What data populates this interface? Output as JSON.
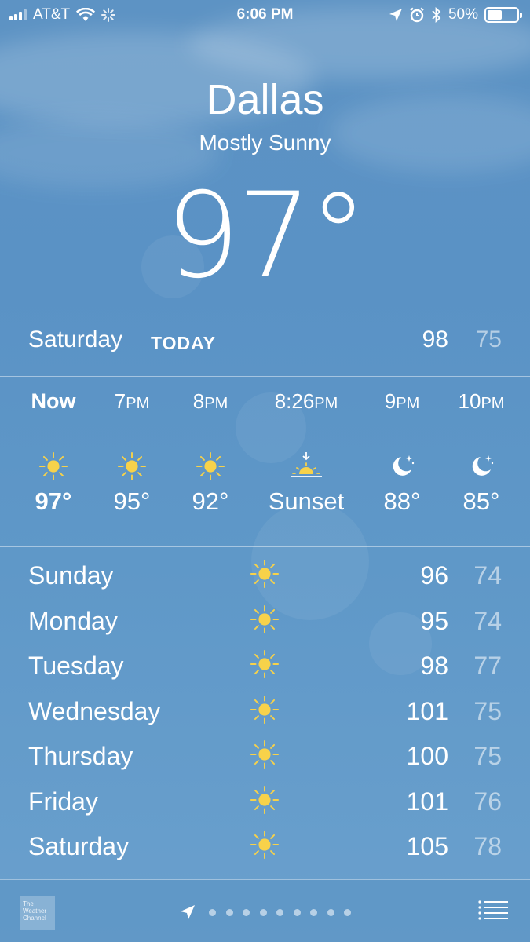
{
  "status_bar": {
    "carrier": "AT&T",
    "time": "6:06 PM",
    "battery": "50%",
    "battery_level": 0.5
  },
  "location": {
    "city": "Dallas",
    "condition": "Mostly Sunny",
    "temperature": "97°"
  },
  "today": {
    "day": "Saturday",
    "label": "TODAY",
    "high": "98",
    "low": "75"
  },
  "hourly": [
    {
      "time": "Now",
      "ampm": "",
      "icon": "sun-icon",
      "temp": "97°",
      "is_now": true
    },
    {
      "time": "7",
      "ampm": "PM",
      "icon": "sun-icon",
      "temp": "95°"
    },
    {
      "time": "8",
      "ampm": "PM",
      "icon": "sun-icon",
      "temp": "92°"
    },
    {
      "time": "8:26",
      "ampm": "PM",
      "icon": "sunset-icon",
      "temp": "Sunset"
    },
    {
      "time": "9",
      "ampm": "PM",
      "icon": "moon-icon",
      "temp": "88°"
    },
    {
      "time": "10",
      "ampm": "PM",
      "icon": "moon-icon",
      "temp": "85°"
    }
  ],
  "daily": [
    {
      "day": "Sunday",
      "icon": "sun-icon",
      "high": "96",
      "low": "74"
    },
    {
      "day": "Monday",
      "icon": "sun-icon",
      "high": "95",
      "low": "74"
    },
    {
      "day": "Tuesday",
      "icon": "sun-icon",
      "high": "98",
      "low": "77"
    },
    {
      "day": "Wednesday",
      "icon": "sun-icon",
      "high": "101",
      "low": "75"
    },
    {
      "day": "Thursday",
      "icon": "sun-icon",
      "high": "100",
      "low": "75"
    },
    {
      "day": "Friday",
      "icon": "sun-icon",
      "high": "101",
      "low": "76"
    },
    {
      "day": "Saturday",
      "icon": "sun-icon",
      "high": "105",
      "low": "78"
    }
  ],
  "bottom_bar": {
    "logo_text": "The Weather Channel",
    "page_count": 9
  },
  "colors": {
    "sun": "#f7d24a",
    "background": "#5d93c4"
  }
}
